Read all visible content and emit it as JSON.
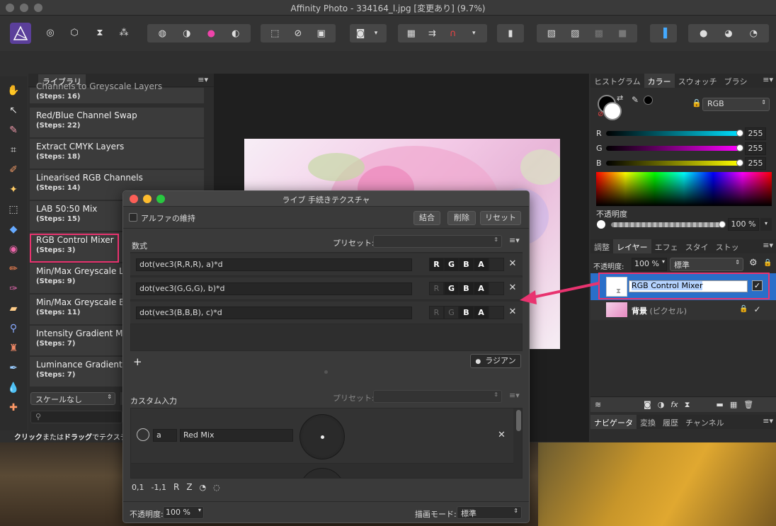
{
  "window": {
    "title": "Affinity Photo - 334164_l.jpg [変更あり] (9.7%)"
  },
  "library": {
    "tab": "ライブラリ",
    "partial_item": {
      "name": "Channels to Greyscale Layers",
      "steps": "(Steps: 16)"
    },
    "items": [
      {
        "name": "Red/Blue Channel Swap",
        "steps": "(Steps: 22)"
      },
      {
        "name": "Extract CMYK Layers",
        "steps": "(Steps: 18)"
      },
      {
        "name": "Linearised RGB Channels",
        "steps": "(Steps: 14)"
      },
      {
        "name": "LAB 50:50 Mix",
        "steps": "(Steps: 15)"
      },
      {
        "name": "RGB Control Mixer",
        "steps": "(Steps: 3)"
      },
      {
        "name": "Min/Max Greyscale Layers",
        "steps": "(Steps: 9)"
      },
      {
        "name": "Min/Max Greyscale Blend",
        "steps": "(Steps: 11)"
      },
      {
        "name": "Intensity Gradient Map",
        "steps": "(Steps: 7)"
      },
      {
        "name": "Luminance Gradient Map",
        "steps": "(Steps: 7)"
      }
    ],
    "scale_select": "スケールなし",
    "hint_bold1": "クリック",
    "hint_mid": "または",
    "hint_bold2": "ドラッグ",
    "hint_rest": "でテクスチャ"
  },
  "dialog": {
    "title": "ライブ 手続きテクスチャ",
    "alpha_label": "アルファの維持",
    "merge_btn": "結合",
    "delete_btn": "削除",
    "reset_btn": "リセット",
    "equation_label": "数式",
    "preset_label": "プリセット:",
    "equations": [
      {
        "expr": "dot(vec3(R,R,R), a)*d",
        "channels": [
          "R",
          "G",
          "B",
          "A"
        ]
      },
      {
        "expr": "dot(vec3(G,G,G), b)*d",
        "channels": [
          "R",
          "G",
          "B",
          "A"
        ]
      },
      {
        "expr": "dot(vec3(B,B,B), c)*d",
        "channels": [
          "R",
          "G",
          "B",
          "A"
        ]
      }
    ],
    "add_symbol": "+",
    "radian_label": "ラジアン",
    "custom_input_label": "カスタム入力",
    "preset_label2": "プリセット:",
    "input_var": "a",
    "input_name": "Red Mix",
    "bottom_tools": [
      "0,1",
      "-1,1",
      "R",
      "Z"
    ],
    "opacity_label": "不透明度:",
    "opacity_value": "100 %",
    "blend_label": "描画モード:",
    "blend_value": "標準"
  },
  "color_panel": {
    "tabs": [
      "ヒストグラム",
      "カラー",
      "スウォッチ",
      "ブラシ"
    ],
    "active_tab": "カラー",
    "model": "RGB",
    "channels": [
      {
        "label": "R",
        "value": "255",
        "color": "#00e0ff"
      },
      {
        "label": "G",
        "value": "255",
        "color": "#ff00ff"
      },
      {
        "label": "B",
        "value": "255",
        "color": "#ffff00"
      }
    ],
    "opacity_label": "不透明度",
    "opacity_value": "100 %"
  },
  "layers_panel": {
    "tabs": [
      "調整",
      "レイヤー",
      "エフェ",
      "スタイ",
      "ストッ"
    ],
    "active_tab": "レイヤー",
    "opacity_label": "不透明度:",
    "opacity_value": "100 %",
    "blend_value": "標準",
    "layers": [
      {
        "name": "RGB Control Mixer",
        "selected": true
      },
      {
        "name": "背景",
        "suffix": " (ピクセル)",
        "selected": false
      }
    ]
  },
  "navigator_panel": {
    "tabs": [
      "ナビゲータ",
      "変換",
      "履歴",
      "チャンネル"
    ],
    "active_tab": "ナビゲータ"
  },
  "accent": "#e8336f"
}
